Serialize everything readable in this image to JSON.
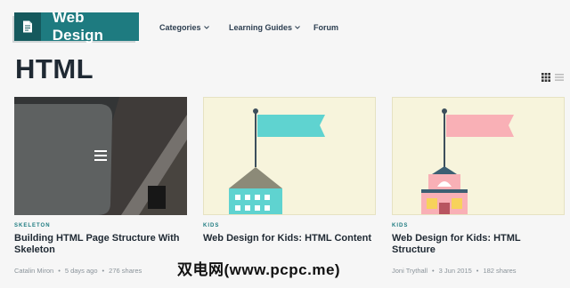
{
  "logo": {
    "text": "Web Design",
    "icon": "document-icon"
  },
  "nav": [
    {
      "label": "Categories",
      "has_dropdown": true
    },
    {
      "label": "Learning Guides",
      "has_dropdown": true
    },
    {
      "label": "Forum",
      "has_dropdown": false
    }
  ],
  "page": {
    "title": "HTML"
  },
  "view_toggle": {
    "grid_icon": "grid-view-icon",
    "list_icon": "list-view-icon"
  },
  "cards": [
    {
      "tag": "SKELETON",
      "title": "Building HTML Page Structure With Skeleton",
      "author": "Catalin Miron",
      "date": "5 days ago",
      "shares": "276 shares",
      "thumb_icon": "menu-icon"
    },
    {
      "tag": "KIDS",
      "title": "Web Design for Kids: HTML Content",
      "author": "",
      "date": "",
      "shares": "",
      "thumb_icon": "flag-building-illustration"
    },
    {
      "tag": "KIDS",
      "title": "Web Design for Kids: HTML Structure",
      "author": "Joni Trythall",
      "date": "3 Jun 2015",
      "shares": "182 shares",
      "thumb_icon": "flag-school-illustration"
    }
  ],
  "watermark": "双电网(www.pcpc.me)",
  "colors": {
    "brand": "#1e7b80",
    "brand_dark": "#15595d",
    "teal_flag": "#5fd3d0",
    "pink_flag": "#f9b0b6"
  }
}
